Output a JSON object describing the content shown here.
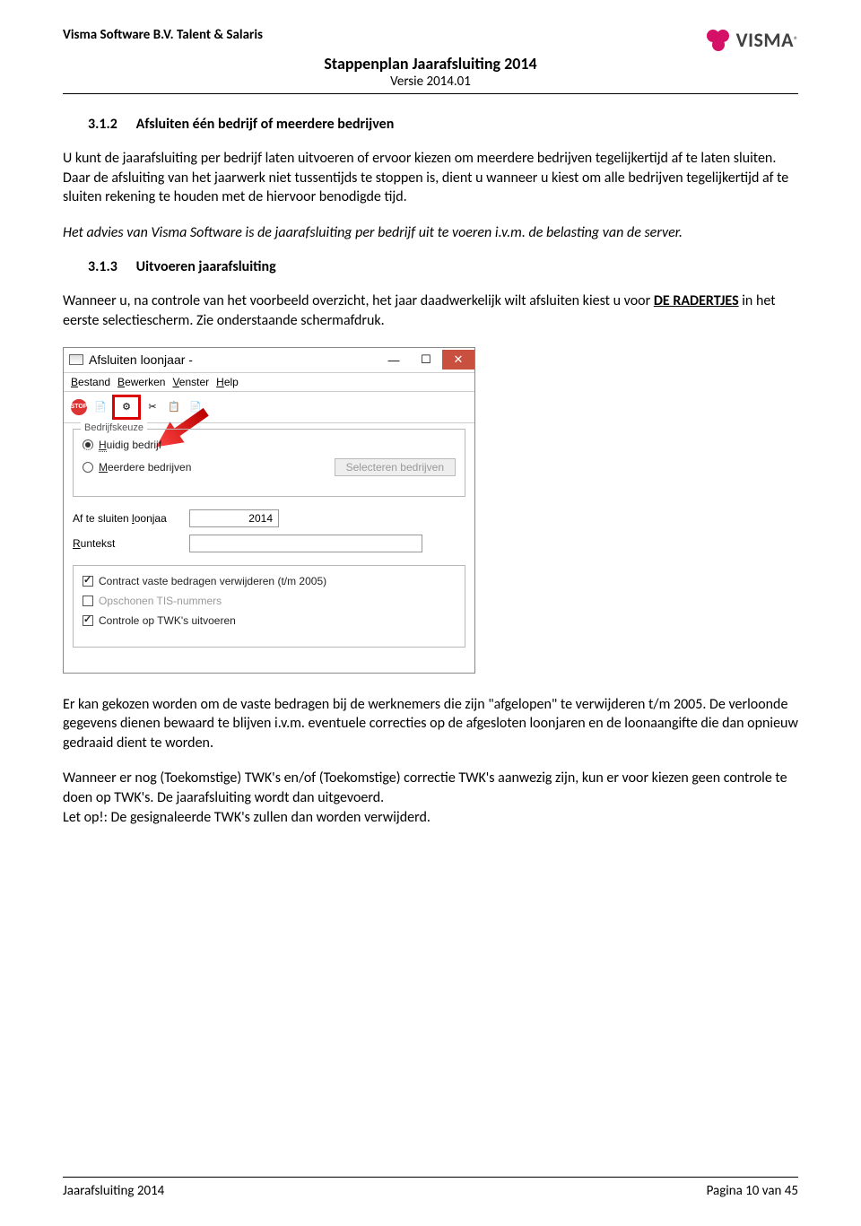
{
  "header": {
    "company": "Visma Software B.V. Talent & Salaris",
    "title": "Stappenplan Jaarafsluiting 2014",
    "version": "Versie 2014.01",
    "logo_text": "VISMA"
  },
  "section312": {
    "num": "3.1.2",
    "title": "Afsluiten één bedrijf of meerdere bedrijven",
    "para1": "U kunt de jaarafsluiting per bedrijf laten uitvoeren of ervoor kiezen om meerdere bedrijven tegelijkertijd af te laten sluiten. Daar de afsluiting van het jaarwerk niet tussentijds te stoppen is, dient u wanneer u kiest om alle bedrijven tegelijkertijd af te sluiten rekening te houden met de hiervoor benodigde tijd.",
    "para1_italic": "Het advies van Visma Software is de jaarafsluiting per bedrijf uit te voeren i.v.m. de belasting van de server."
  },
  "section313": {
    "num": "3.1.3",
    "title": "Uitvoeren jaarafsluiting",
    "para1a": "Wanneer u, na controle van het voorbeeld overzicht, het jaar daadwerkelijk wilt afsluiten kiest u voor ",
    "para1_uline": "DE RADERTJES",
    "para1b": "  in het eerste selectiescherm. Zie onderstaande schermafdruk."
  },
  "screenshot": {
    "win_title": "Afsluiten loonjaar -",
    "menu": {
      "bestand": "Bestand",
      "bewerken": "Bewerken",
      "venster": "Venster",
      "help": "Help"
    },
    "toolbar_stop": "STOP",
    "group_legend": "Bedrijfskeuze",
    "radio1": "Huidig bedrijf",
    "radio2": "Meerdere bedrijven",
    "select_btn": "Selecteren bedrijven",
    "field_loonjaar_label": "Af te sluiten loonjaa",
    "field_loonjaar_value": "2014",
    "field_runtekst_label": "Runtekst",
    "check1": "Contract vaste bedragen verwijderen (t/m 2005)",
    "check2": "Opschonen TIS-nummers",
    "check3": "Controle op TWK's uitvoeren"
  },
  "after_shot": {
    "para1": "Er kan gekozen worden om de vaste bedragen bij de werknemers die zijn \"afgelopen\" te verwijderen t/m 2005. De verloonde gegevens dienen bewaard te blijven i.v.m. eventuele correcties op de afgesloten loonjaren en de loonaangifte die dan opnieuw gedraaid dient te worden.",
    "para2": "Wanneer er nog (Toekomstige) TWK's en/of (Toekomstige) correctie TWK's aanwezig zijn, kun er voor kiezen geen controle te doen op TWK's. De jaarafsluiting wordt dan uitgevoerd.",
    "para3": "Let op!: De gesignaleerde TWK's zullen dan worden verwijderd."
  },
  "footer": {
    "left": "Jaarafsluiting 2014",
    "right": "Pagina 10 van 45"
  }
}
